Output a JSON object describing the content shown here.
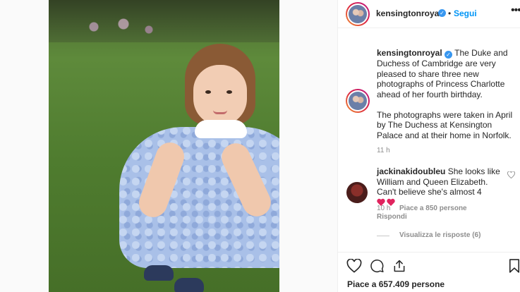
{
  "post": {
    "username": "kensingtonroyal",
    "verified_mark": "✓",
    "separator": "•",
    "follow_label": "Segui",
    "more_label": "•••",
    "caption_line1": "The Duke and Duchess of Cambridge are very pleased to share three new photographs of Princess Charlotte ahead of her fourth birthday.",
    "caption_line2": "The photographs were taken in April by The Duchess at Kensington Palace and at their home in Norfolk.",
    "caption_time": "11 h"
  },
  "comment": {
    "username": "jackinakidoubleu",
    "text": "She looks like William and Queen Elizabeth. Can't believe she's almost 4",
    "time": "10 h",
    "likes": "Piace a 850 persone",
    "reply_label": "Rispondi",
    "view_replies": "Visualizza le risposte (6)"
  },
  "actions": {
    "like_icon": "heart-outline-icon",
    "comment_icon": "comment-bubble-icon",
    "share_icon": "share-upload-icon",
    "save_icon": "bookmark-icon",
    "likes_count": "Piace a 657.409 persone"
  },
  "colors": {
    "link_blue": "#0095f6",
    "verified_blue": "#3897f0",
    "muted_text": "#8e8e8e",
    "heart_red": "#e0245e"
  }
}
